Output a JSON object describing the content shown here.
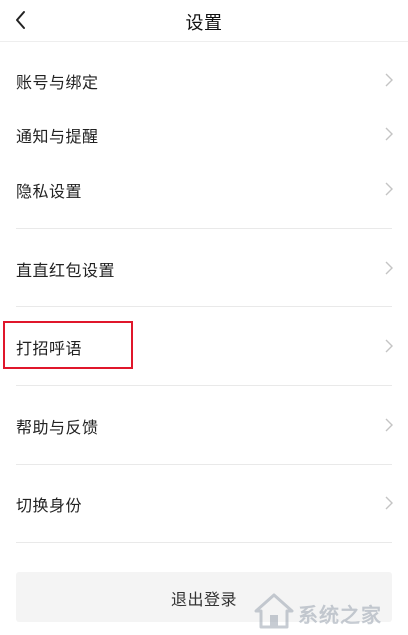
{
  "header": {
    "title": "设置"
  },
  "settings": {
    "items": [
      {
        "label": "账号与绑定"
      },
      {
        "label": "通知与提醒"
      },
      {
        "label": "隐私设置"
      },
      {
        "label": "直直红包设置"
      },
      {
        "label": "打招呼语"
      },
      {
        "label": "帮助与反馈"
      },
      {
        "label": "切换身份"
      }
    ]
  },
  "logout": {
    "label": "退出登录"
  },
  "watermark": {
    "text": "系统之家"
  },
  "colors": {
    "highlight": "#e0162b",
    "divider": "#e9e9e9",
    "chevron": "#c4c4c4",
    "logout_bg": "#f4f4f4"
  }
}
